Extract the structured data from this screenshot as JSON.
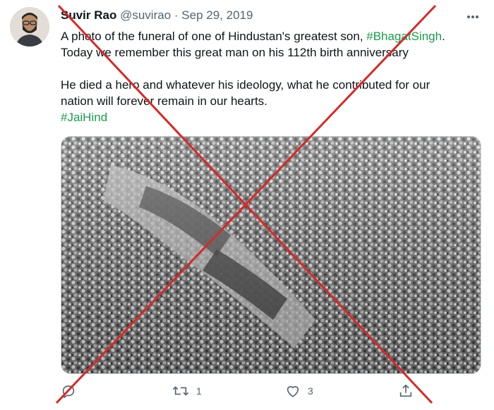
{
  "tweet": {
    "display_name": "Suvir Rao",
    "handle": "@suvirao",
    "separator": "·",
    "date": "Sep 29, 2019",
    "text_line1": "A photo of the funeral of one of Hindustan's greatest son, ",
    "hashtag1": "#BhagatSingh",
    "text_line1_end": ".",
    "text_line2": "Today we remember this great man on his 112th birth anniversary",
    "text_line3": "He died a hero and whatever his ideology, what he contributed for our",
    "text_line4": "nation will forever remain in our hearts.",
    "hashtag2": "#JaiHind"
  },
  "actions": {
    "reply_count": "",
    "retweet_count": "1",
    "like_count": "3"
  },
  "icons": [
    "more-icon",
    "reply-icon",
    "retweet-icon",
    "like-icon",
    "share-icon"
  ],
  "colors": {
    "hashtag": "#1a9c4e",
    "cross": "#d42a2a",
    "meta": "#536471"
  }
}
